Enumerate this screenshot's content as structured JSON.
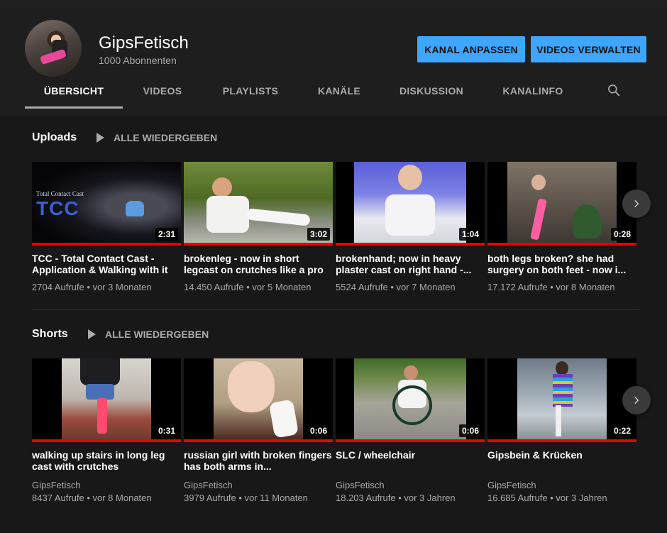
{
  "channel": {
    "name": "GipsFetisch",
    "subscribers": "1000 Abonnenten",
    "customize_label": "KANAL ANPASSEN",
    "manage_label": "VIDEOS VERWALTEN"
  },
  "tabs": [
    {
      "label": "ÜBERSICHT",
      "active": true
    },
    {
      "label": "VIDEOS"
    },
    {
      "label": "PLAYLISTS"
    },
    {
      "label": "KANÄLE"
    },
    {
      "label": "DISKUSSION"
    },
    {
      "label": "KANALINFO"
    }
  ],
  "uploads": {
    "title": "Uploads",
    "play_all": "ALLE WIEDERGEBEN",
    "videos": [
      {
        "title": "TCC - Total Contact Cast - Application & Walking with it",
        "duration": "2:31",
        "views": "2704 Aufrufe",
        "age": "vor 3 Monaten",
        "overlay_small": "Total Contact Cast",
        "overlay_big": "TCC"
      },
      {
        "title": "brokenleg - now in short legcast on crutches like a pro",
        "duration": "3:02",
        "views": "14.450 Aufrufe",
        "age": "vor 5 Monaten"
      },
      {
        "title": "brokenhand; now in heavy plaster cast on right hand -...",
        "duration": "1:04",
        "views": "5524 Aufrufe",
        "age": "vor 7 Monaten"
      },
      {
        "title": "both legs broken? she had surgery on both feet - now i...",
        "duration": "0:28",
        "views": "17.172 Aufrufe",
        "age": "vor 8 Monaten"
      }
    ]
  },
  "shorts": {
    "title": "Shorts",
    "play_all": "ALLE WIEDERGEBEN",
    "videos": [
      {
        "title": "walking up stairs in long leg cast with crutches",
        "duration": "0:31",
        "channel": "GipsFetisch",
        "views": "8437 Aufrufe",
        "age": "vor 8 Monaten"
      },
      {
        "title": "russian girl with broken fingers has both arms in...",
        "duration": "0:06",
        "channel": "GipsFetisch",
        "views": "3979 Aufrufe",
        "age": "vor 11 Monaten"
      },
      {
        "title": "SLC / wheelchair",
        "duration": "0:06",
        "channel": "GipsFetisch",
        "views": "18.203 Aufrufe",
        "age": "vor 3 Jahren"
      },
      {
        "title": "Gipsbein & Krücken",
        "duration": "0:22",
        "channel": "GipsFetisch",
        "views": "16.685 Aufrufe",
        "age": "vor 3 Jahren"
      }
    ]
  },
  "colors": {
    "accent": "#3ea6ff",
    "progress": "#ff0000",
    "background": "#181818"
  },
  "icons": {
    "search": "search-icon",
    "next": "chevron-right-icon",
    "play": "play-icon"
  }
}
